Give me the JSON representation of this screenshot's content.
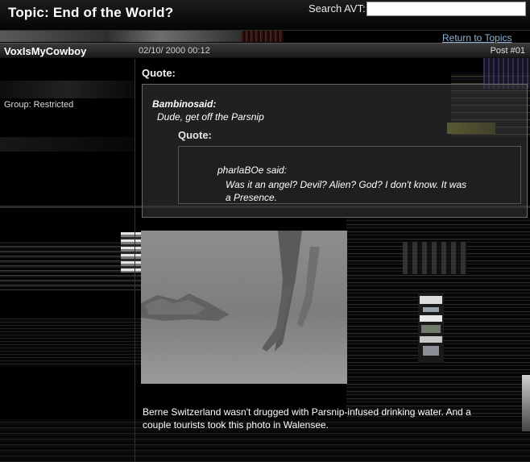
{
  "topic": {
    "title": "Topic:  End of the World?"
  },
  "search": {
    "label": "Search AVT:",
    "value": ""
  },
  "nav": {
    "return_label": "Return to Topics"
  },
  "post": {
    "author": "VoxIsMyCowboy",
    "date": "02/10/ 2000 00:12",
    "number": "Post #01",
    "group": "Group:  Restricted"
  },
  "quote_outer": {
    "label": "Quote:",
    "said": "Bambinosaid:",
    "text": "Dude, get off the Parsnip"
  },
  "quote_inner": {
    "label": "Quote:",
    "said": "pharlaBOe said:",
    "text": "Was it an angel? Devil? Alien? God? I don't know. It was a Presence."
  },
  "photo": {
    "subject": "grainy-monochrome-photo-of-figure-legs"
  },
  "body": {
    "text": "Berne Switzerland wasn't drugged with Parsnip-infused drinking water. And a couple tourists took this photo in Walensee."
  },
  "colors": {
    "background": "#000000",
    "link": "#8fb2d8",
    "header_bar": "#2a2a2a",
    "quote_box": "#3a3a3a"
  }
}
